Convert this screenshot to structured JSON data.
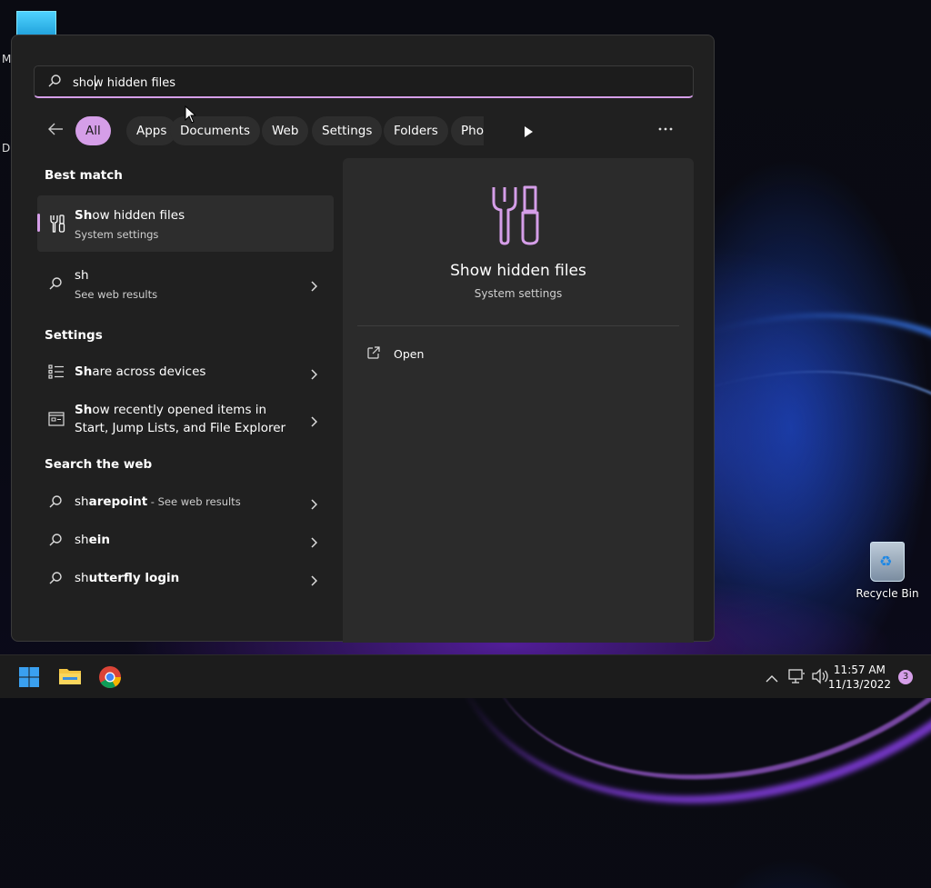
{
  "desktop": {
    "fragment_m": "M",
    "fragment_d": "D",
    "recycle_bin_label": "Recycle Bin"
  },
  "search": {
    "value": "show hidden files",
    "icon": "search-icon"
  },
  "filters": {
    "chips": [
      "All",
      "Apps",
      "Documents",
      "Web",
      "Settings",
      "Folders",
      "Phot"
    ],
    "active": "All"
  },
  "results": {
    "best_match_header": "Best match",
    "best_match": {
      "title_bold": "Sh",
      "title_rest": "ow hidden files",
      "subtitle": "System settings",
      "icon": "tools-icon"
    },
    "web_sh": {
      "title": "sh",
      "subtitle": "See web results",
      "icon": "search-icon"
    },
    "settings_header": "Settings",
    "settings": [
      {
        "bold": "Sh",
        "rest": "are across devices",
        "icon": "list-icon"
      },
      {
        "bold": "Sh",
        "rest_line1": "ow recently opened items in",
        "line2": "Start, Jump Lists, and File Explorer",
        "icon": "start-menu-icon"
      }
    ],
    "web_header": "Search the web",
    "web": [
      {
        "bold": "sh",
        "rest": "arepoint",
        "suffix": " - See web results"
      },
      {
        "bold": "sh",
        "rest": "ein",
        "suffix": ""
      },
      {
        "bold": "sh",
        "rest": "utterfly login",
        "suffix": ""
      }
    ]
  },
  "preview": {
    "title": "Show hidden files",
    "subtitle": "System settings",
    "action_open": "Open",
    "accent": "#d59ee8"
  },
  "taskbar": {
    "time": "11:57 AM",
    "date": "11/13/2022",
    "notifications": "3"
  }
}
